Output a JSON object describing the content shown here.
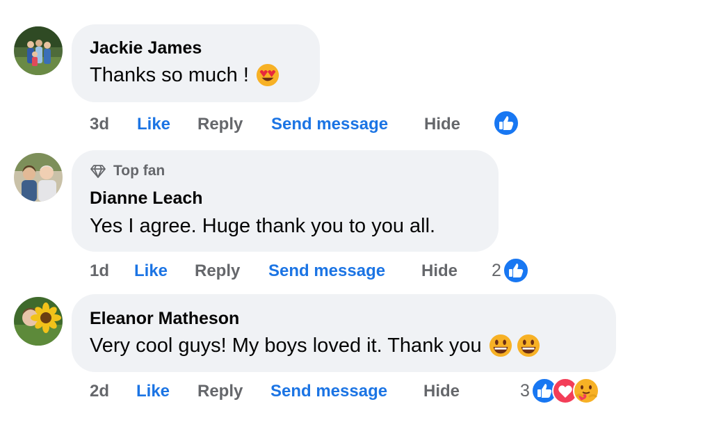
{
  "comments": [
    {
      "author": "Jackie James",
      "text": "Thanks so much !",
      "time": "3d",
      "like_label": "Like",
      "reply_label": "Reply",
      "send_message_label": "Send message",
      "hide_label": "Hide",
      "reaction_count": "",
      "reactions": [
        "like-reaction-icon"
      ],
      "text_emojis": [
        "heart-eyes-emoji-icon"
      ]
    },
    {
      "badge": "Top fan",
      "author": "Dianne Leach",
      "text": "Yes I agree. Huge thank you to you all.",
      "time": "1d",
      "like_label": "Like",
      "reply_label": "Reply",
      "send_message_label": "Send message",
      "hide_label": "Hide",
      "reaction_count": "2",
      "reactions": [
        "like-reaction-icon"
      ]
    },
    {
      "author": "Eleanor Matheson",
      "text": "Very cool guys! My boys loved it. Thank you",
      "time": "2d",
      "like_label": "Like",
      "reply_label": "Reply",
      "send_message_label": "Send message",
      "hide_label": "Hide",
      "reaction_count": "3",
      "reactions": [
        "like-reaction-icon",
        "love-reaction-icon",
        "care-reaction-icon"
      ],
      "text_emojis": [
        "grinning-emoji-icon",
        "grinning-emoji-icon"
      ]
    }
  ],
  "colors": {
    "bubble_bg": "#f0f2f5",
    "link_blue": "#1b74e4",
    "meta_grey": "#65676b",
    "like_blue": "#1877f2",
    "love_red": "#f33e58",
    "emoji_yellow": "#f7b125"
  }
}
